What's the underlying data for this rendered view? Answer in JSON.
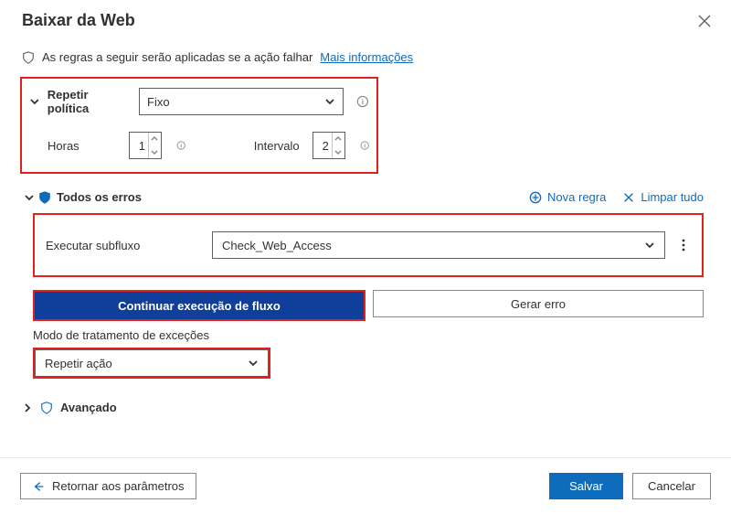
{
  "title": "Baixar da Web",
  "info_bar": {
    "text": "As regras a seguir serão aplicadas se a ação falhar",
    "link": "Mais informações"
  },
  "retry": {
    "label": "Repetir política",
    "selected": "Fixo",
    "hours_label": "Horas",
    "hours_value": "1",
    "interval_label": "Intervalo",
    "interval_value": "2"
  },
  "errors": {
    "title": "Todos os erros",
    "new_rule": "Nova regra",
    "clear_all": "Limpar tudo",
    "subflow_label": "Executar subfluxo",
    "subflow_value": "Check_Web_Access",
    "continue_btn": "Continuar execução de fluxo",
    "throw_btn": "Gerar erro",
    "mode_label": "Modo de tratamento de exceções",
    "mode_value": "Repetir ação"
  },
  "advanced": "Avançado",
  "footer": {
    "back": "Retornar aos parâmetros",
    "save": "Salvar",
    "cancel": "Cancelar"
  }
}
